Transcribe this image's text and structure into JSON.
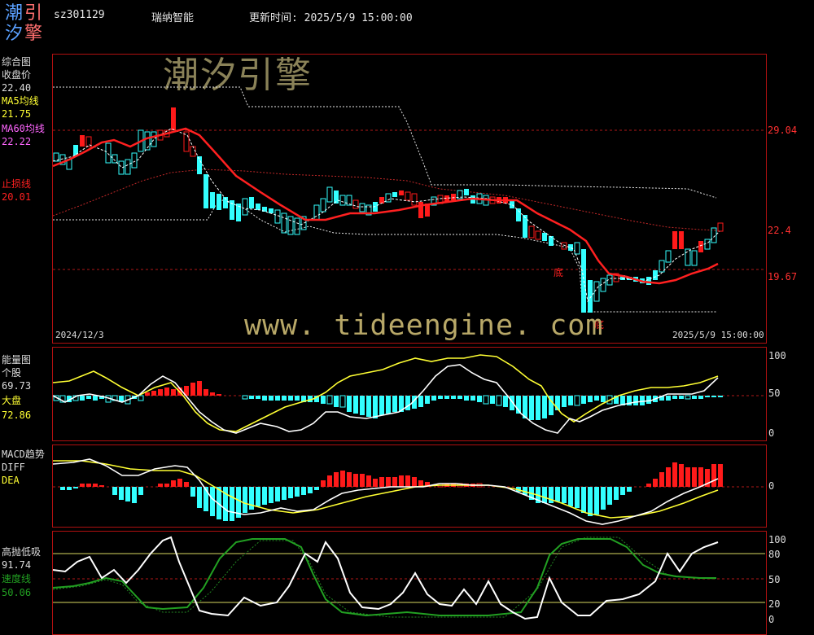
{
  "logo": {
    "c1": "潮",
    "c2": "引",
    "c3": "汐",
    "c4": "擎"
  },
  "header": {
    "code": "sz301129",
    "name": "瑞纳智能",
    "update": "更新时间: 2025/5/9 15:00:00"
  },
  "main_panel": {
    "title": "综合图",
    "close_label": "收盘价",
    "close_value": "22.40",
    "ma5_label": "MA5均线",
    "ma5_value": "21.75",
    "ma60_label": "MA60均线",
    "ma60_value": "22.22",
    "stop_label": "止损线",
    "stop_value": "20.01",
    "levels": [
      "29.04",
      "22.4",
      "19.67"
    ],
    "start_date": "2024/12/3",
    "end_date": "2025/5/9 15:00:00",
    "bottom_marks": [
      "底",
      "底"
    ]
  },
  "energy_panel": {
    "title": "能量图",
    "stock_label": "个股",
    "stock_value": "69.73",
    "market_label": "大盘",
    "market_value": "72.86",
    "scale": [
      "100",
      "50",
      "0"
    ]
  },
  "macd_panel": {
    "title": "MACD趋势",
    "diff_label": "DIFF",
    "dea_label": "DEA",
    "scale": [
      "0"
    ]
  },
  "hl_panel": {
    "title": "高抛低吸",
    "value": "91.74",
    "speed_label": "速度线",
    "speed_value": "50.06",
    "scale": [
      "100",
      "80",
      "50",
      "20",
      "0"
    ]
  },
  "watermarks": {
    "cn": "潮汐引擎",
    "url": "www. tideengine. com"
  },
  "colors": {
    "up": "#ff1a1a",
    "down": "#33ffff",
    "ma_red": "#ff2020",
    "yellow": "#ffff33",
    "green": "#22a022",
    "frame": "#b01010"
  }
}
